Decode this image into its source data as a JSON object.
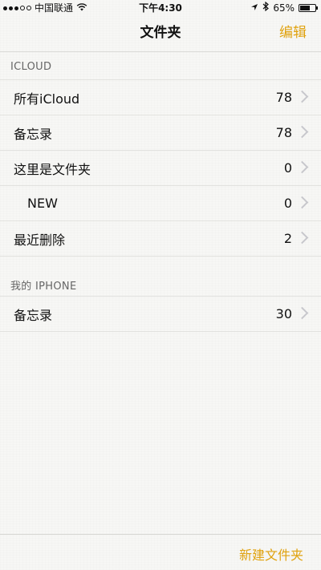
{
  "status_bar": {
    "carrier": "中国联通",
    "time": "下午4:30",
    "battery": "65%",
    "battery_level": 0.65,
    "signal_bars": 3
  },
  "nav": {
    "title": "文件夹",
    "edit_label": "编辑"
  },
  "sections": [
    {
      "header": "ICLOUD",
      "rows": [
        {
          "label": "所有iCloud",
          "count": "78"
        },
        {
          "label": "备忘录",
          "count": "78"
        },
        {
          "label": "这里是文件夹",
          "count": "0"
        },
        {
          "label": "NEW",
          "count": "0"
        },
        {
          "label": "最近删除",
          "count": "2"
        }
      ]
    },
    {
      "header": "我的 IPHONE",
      "rows": [
        {
          "label": "备忘录",
          "count": "30"
        }
      ]
    }
  ],
  "toolbar": {
    "new_folder_label": "新建文件夹"
  },
  "colors": {
    "accent": "#e0a20e",
    "background": "#f7f7f5"
  }
}
